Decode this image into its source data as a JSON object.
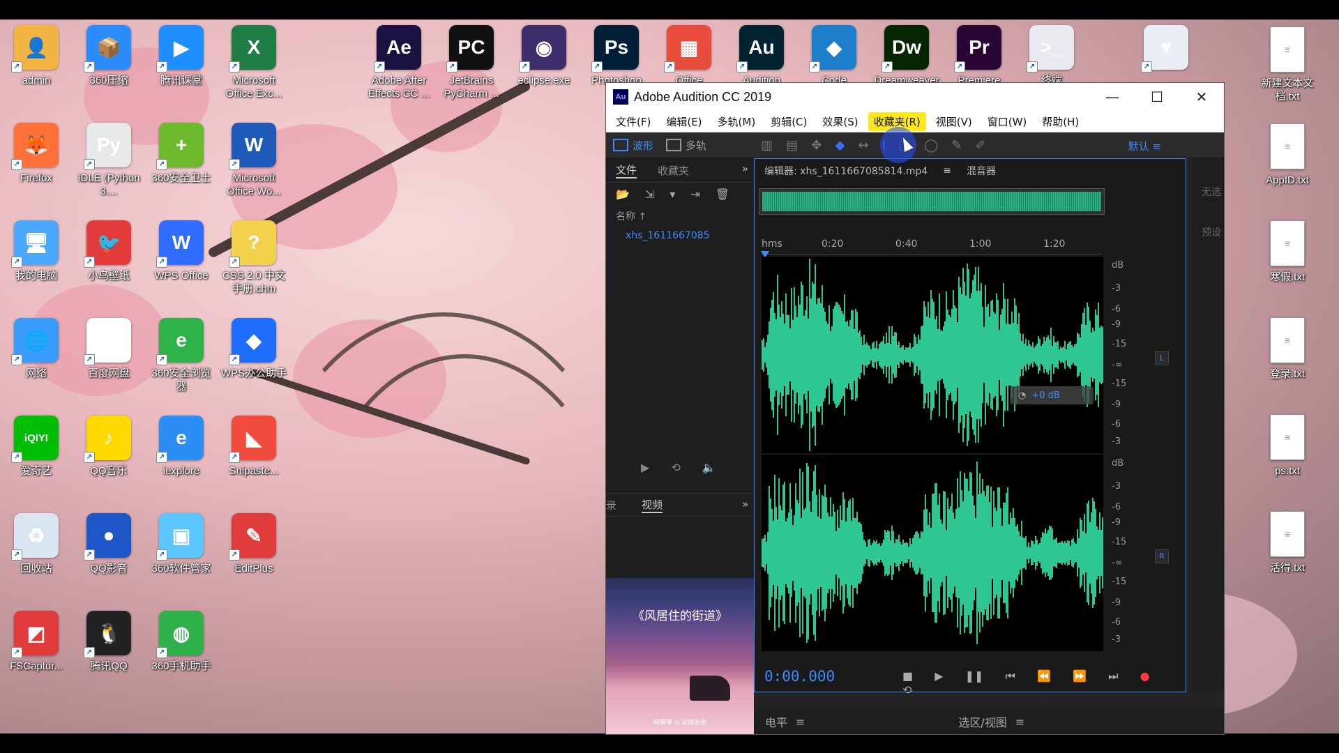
{
  "desktop": {
    "icons": [
      {
        "label": "admin",
        "color": "#f3b443",
        "glyph": "👤"
      },
      {
        "label": "360压缩",
        "color": "#2a8cff",
        "glyph": "📦"
      },
      {
        "label": "腾讯课堂",
        "color": "#1f8fff",
        "glyph": "▶"
      },
      {
        "label": "Microsoft Office Exc...",
        "color": "#1e7e45",
        "glyph": "X"
      },
      {
        "label": "Adobe After Effects CC ...",
        "color": "#1a1140",
        "glyph": "Ae"
      },
      {
        "label": "JetBrains PyCharm ...",
        "color": "#111",
        "glyph": "PC"
      },
      {
        "label": "eclipse.exe",
        "color": "#3c2e6b",
        "glyph": "◉"
      },
      {
        "label": "Photoshop",
        "color": "#001e36",
        "glyph": "Ps"
      },
      {
        "label": "Office",
        "color": "#e74c3c",
        "glyph": "▦"
      },
      {
        "label": "Audition",
        "color": "#00232f",
        "glyph": "Au"
      },
      {
        "label": "Code",
        "color": "#1d7fcc",
        "glyph": "◆"
      },
      {
        "label": "Dreamweaver",
        "color": "#072401",
        "glyph": "Dw"
      },
      {
        "label": "Premiere",
        "color": "#2a0634",
        "glyph": "Pr"
      },
      {
        "label": "终端",
        "color": "#e8eaf0",
        "glyph": ">_"
      },
      {
        "label": "",
        "color": "#e9eef4",
        "glyph": "♥"
      },
      {
        "label": "Firefox",
        "color": "#ff7139",
        "glyph": "🦊"
      },
      {
        "label": "IDLE (Python 3....",
        "color": "#e8e8e8",
        "glyph": "Py"
      },
      {
        "label": "360安全卫士",
        "color": "#6dbb2d",
        "glyph": "+"
      },
      {
        "label": "Microsoft Office Wo...",
        "color": "#1e5bb8",
        "glyph": "W"
      },
      {
        "label": "我的电脑",
        "color": "#4aa8ff",
        "glyph": "🖥"
      },
      {
        "label": "小鸟壁纸",
        "color": "#e23b3b",
        "glyph": "🐦"
      },
      {
        "label": "WPS Office",
        "color": "#2f6cff",
        "glyph": "W"
      },
      {
        "label": "CSS 2.0 中文手册.chm",
        "color": "#f2d24a",
        "glyph": "?"
      },
      {
        "label": "网络",
        "color": "#3a9bff",
        "glyph": "🌐"
      },
      {
        "label": "百度网盘",
        "color": "#ffffff",
        "glyph": "☁"
      },
      {
        "label": "360安全浏览器",
        "color": "#2db34a",
        "glyph": "e"
      },
      {
        "label": "WPS办公助手",
        "color": "#1e6dff",
        "glyph": "◆"
      },
      {
        "label": "爱奇艺",
        "color": "#00be06",
        "glyph": "iQIYI"
      },
      {
        "label": "QQ音乐",
        "color": "#ffd800",
        "glyph": "♪"
      },
      {
        "label": "iexplore",
        "color": "#2b8ef5",
        "glyph": "e"
      },
      {
        "label": "Snipaste...",
        "color": "#f04b3c",
        "glyph": "◣"
      },
      {
        "label": "回收站",
        "color": "#d9e6f2",
        "glyph": "♻"
      },
      {
        "label": "QQ影音",
        "color": "#1d56c9",
        "glyph": "●"
      },
      {
        "label": "360软件管家",
        "color": "#5bc6ff",
        "glyph": "▣"
      },
      {
        "label": "EditPlus",
        "color": "#e23b3b",
        "glyph": "✎"
      },
      {
        "label": "FSCaptur...",
        "color": "#e03a3a",
        "glyph": "◩"
      },
      {
        "label": "腾讯QQ",
        "color": "#222",
        "glyph": "🐧"
      },
      {
        "label": "360手机助手",
        "color": "#2eb04a",
        "glyph": "◍"
      }
    ],
    "right_icons": [
      {
        "label": "新建文本文档.txt"
      },
      {
        "label": "AppID.txt"
      },
      {
        "label": "寒假.txt"
      },
      {
        "label": "登录.txt"
      },
      {
        "label": "ps.txt"
      },
      {
        "label": "活得.txt"
      }
    ]
  },
  "audition": {
    "title": "Adobe Audition CC 2019",
    "app_icon": "Au",
    "window_buttons": [
      "—",
      "☐",
      "✕"
    ],
    "menu": [
      "文件(F)",
      "编辑(E)",
      "多轨(M)",
      "剪辑(C)",
      "效果(S)",
      "收藏夹(R)",
      "视图(V)",
      "窗口(W)",
      "帮助(H)"
    ],
    "highlighted_menu": "收藏夹(R)",
    "toolbar": {
      "waveform": "波形",
      "multitrack": "多轨",
      "workspace": "默认"
    },
    "files_panel": {
      "tabs": [
        "文件",
        "收藏夹"
      ],
      "name_header": "名称 ↑",
      "files": [
        "xhs_1611667085"
      ]
    },
    "video_panel": {
      "tabs": [
        "录",
        "视频"
      ],
      "thumbnail_title": "《风居住的街道》",
      "thumbnail_sub": "纯钢琴 ◎ 安静治愈"
    },
    "editor": {
      "tab": "编辑器: xhs_1611667085814.mp4",
      "mixer_tab": "混音器",
      "ruler": [
        "hms",
        "0:20",
        "0:40",
        "1:00",
        "1:20"
      ],
      "db_labels": [
        "dB",
        "-3",
        "-6",
        "-9",
        "-15",
        "-∞",
        "-15",
        "-9",
        "-6",
        "-3"
      ],
      "channel_left": "L",
      "channel_right": "R",
      "hud_gain": "+0 dB",
      "timecode": "0:00.000"
    },
    "bottom": {
      "levels": "电平",
      "selection_view": "选区/视图"
    },
    "right_strip": [
      "无选",
      "预设"
    ]
  }
}
